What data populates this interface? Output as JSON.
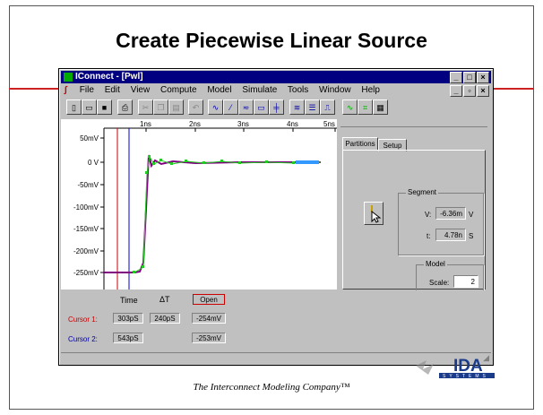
{
  "slide": {
    "title": "Create Piecewise Linear Source",
    "footer": "The Interconnect Modeling Company™"
  },
  "window": {
    "title": "IConnect - [Pwl]",
    "menu": [
      "File",
      "Edit",
      "View",
      "Compute",
      "Model",
      "Simulate",
      "Tools",
      "Window",
      "Help"
    ]
  },
  "plot": {
    "x_ticks": [
      "1ns",
      "2ns",
      "3ns",
      "4ns",
      "5ns"
    ],
    "y_ticks": [
      "50mV",
      "0 V",
      "-50mV",
      "-100mV",
      "-150mV",
      "-200mV",
      "-250mV"
    ]
  },
  "panel": {
    "tab_partitions": "Partitions",
    "tab_setup": "Setup",
    "segment_title": "Segment",
    "v_label": "V:",
    "v_value": "-6.36m",
    "v_unit": "V",
    "t_label": "t:",
    "t_value": "4.78n",
    "t_unit": "S",
    "model_title": "Model",
    "scale_label": "Scale:",
    "scale_value": "2"
  },
  "cursors": {
    "col_time": "Time",
    "col_delta": "ΔT",
    "col_open": "Open",
    "cursor1_label": "Cursor 1:",
    "cursor1_time": "303pS",
    "cursor1_delta": "240pS",
    "cursor1_value": "-254mV",
    "cursor2_label": "Cursor 2:",
    "cursor2_time": "543pS",
    "cursor2_value": "-253mV"
  },
  "colors": {
    "title_bar": "#000080",
    "cursor1": "#cc0000",
    "cursor2": "#0000aa",
    "red_rule": "#cc2222"
  },
  "logo": {
    "text": "IDA",
    "subtext": "SYSTEMS"
  }
}
